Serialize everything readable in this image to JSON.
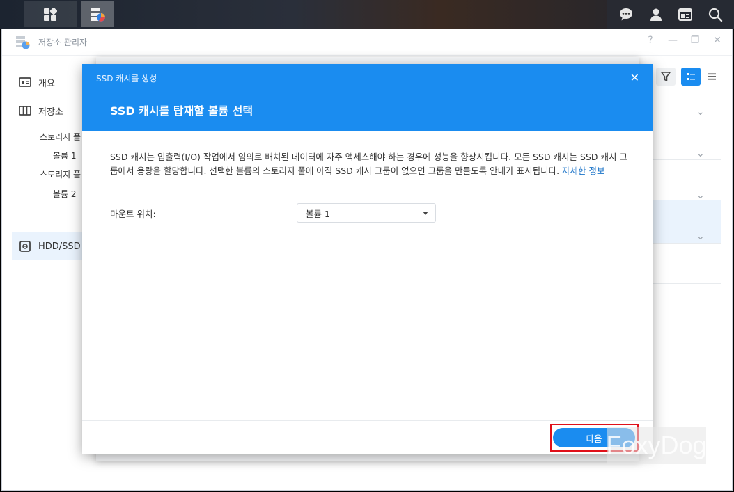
{
  "window": {
    "title": "저장소 관리자",
    "controls": [
      "?",
      "—",
      "❐",
      "✕"
    ]
  },
  "sidebar": {
    "items": [
      {
        "label": "개요",
        "icon": "overview-icon"
      },
      {
        "label": "저장소",
        "icon": "storage-icon"
      },
      {
        "label": "HDD/SSD",
        "icon": "hdd-icon"
      }
    ],
    "subitems": [
      "스토리지 풀",
      "볼륨 1",
      "스토리지 풀",
      "볼륨 2"
    ]
  },
  "dialog": {
    "small_title": "SSD 캐시를 생성",
    "close": "✕",
    "main_title": "SSD 캐시를 탑재할 볼륨 선택",
    "description": "SSD 캐시는 입출력(I/O) 작업에서 임의로 배치된 데이터에 자주 액세스해야 하는 경우에 성능을 향상시킵니다. 모든 SSD 캐시는 SSD 캐시 그룹에서 용량을 할당합니다. 선택한 볼륨의 스토리지 풀에 아직 SSD 캐시 그룹이 없으면 그룹을 만들도록 안내가 표시됩니다. ",
    "link": "자세한 정보",
    "mount_label": "마운트 위치:",
    "mount_value": "볼륨 1",
    "next_button": "다음"
  },
  "watermark": "FoxyDog",
  "colors": {
    "accent": "#1a8cf0",
    "highlight": "#e0101a"
  }
}
